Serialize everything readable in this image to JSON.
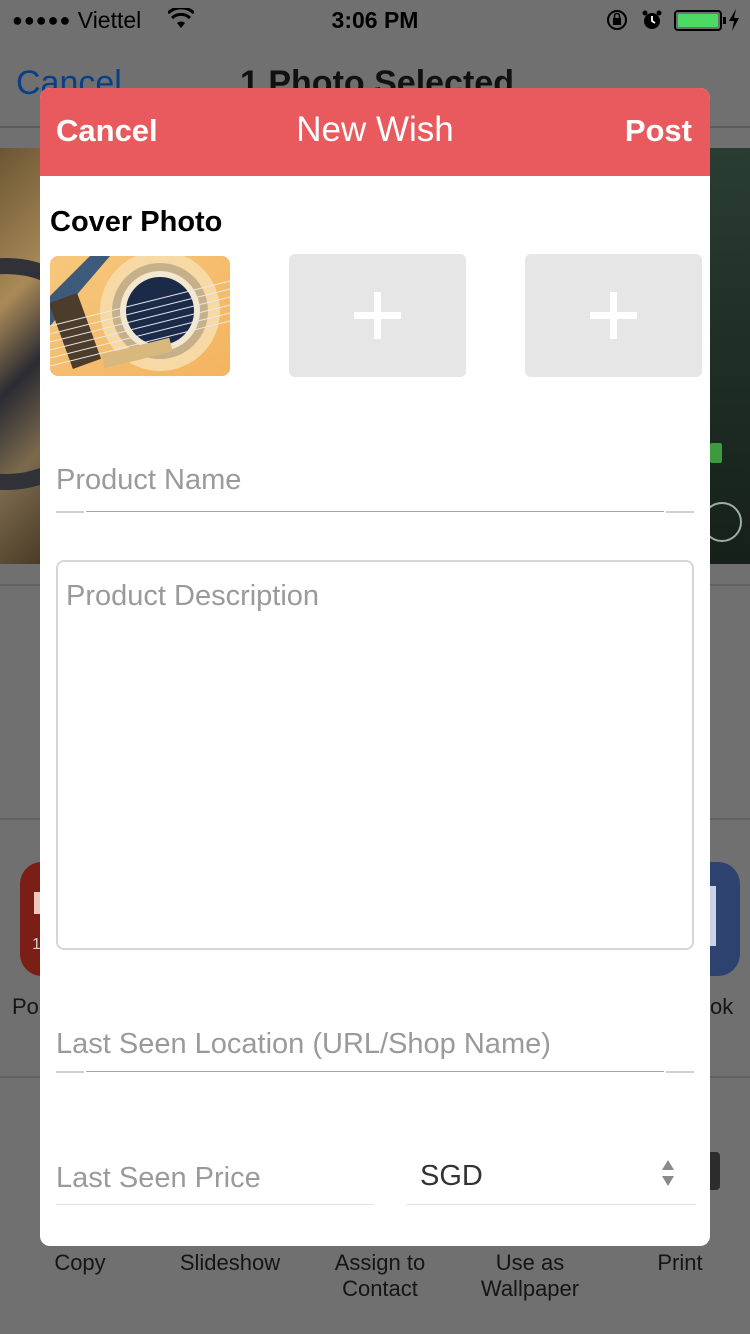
{
  "status_bar": {
    "signal_dots": "●●●●●",
    "carrier": "Viettel",
    "time": "3:06 PM",
    "icons": [
      "wifi-icon",
      "orientation-lock-icon",
      "alarm-icon",
      "battery-icon",
      "charging-bolt-icon"
    ]
  },
  "background": {
    "nav_cancel": "Cancel",
    "nav_title": "1 Photo Selected",
    "app_label_left": "Po",
    "app_label_right": "ok",
    "app_badge_left": "1",
    "actions": [
      {
        "label": "Copy"
      },
      {
        "label": "Slideshow"
      },
      {
        "label": "Assign to Contact"
      },
      {
        "label": "Use as Wallpaper"
      },
      {
        "label": "Print"
      }
    ]
  },
  "modal": {
    "header": {
      "cancel_label": "Cancel",
      "title": "New Wish",
      "post_label": "Post",
      "color": "#e85a5d"
    },
    "cover_photo_label": "Cover Photo",
    "add_photo_slots": 2,
    "product_name_placeholder": "Product Name",
    "product_description_placeholder": "Product Description",
    "location_placeholder": "Last Seen Location (URL/Shop Name)",
    "price_placeholder": "Last Seen Price",
    "currency": {
      "selected": "SGD"
    }
  }
}
